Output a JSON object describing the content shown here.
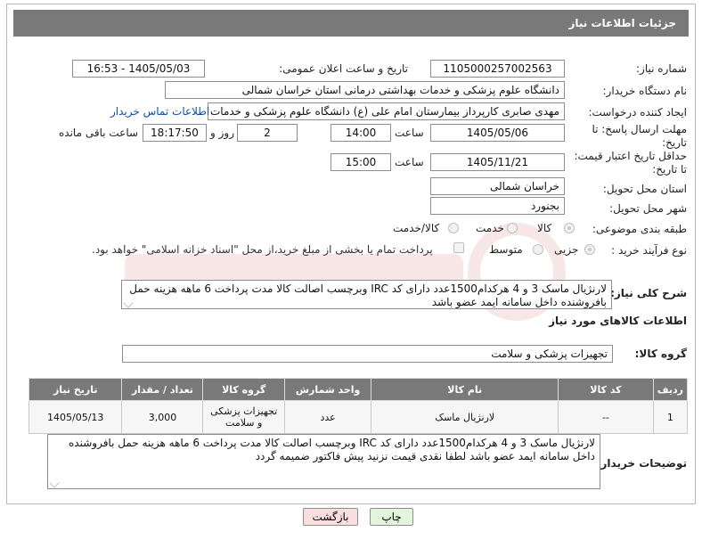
{
  "header": {
    "title": "جزئیات اطلاعات نیاز"
  },
  "fields": {
    "need_number": {
      "label": "شماره نیاز:",
      "value": "1105000257002563"
    },
    "announce_datetime": {
      "label": "تاریخ و ساعت اعلان عمومی:",
      "value": "1405/05/03 - 16:53"
    },
    "buyer_org": {
      "label": "نام دستگاه خریدار:",
      "value": "دانشگاه علوم پزشکی و خدمات بهداشتی درمانی استان خراسان شمالی"
    },
    "requester": {
      "label": "ایجاد کننده درخواست:",
      "value": "مهدی صابری کارپرداز بیمارستان امام علی (ع) دانشگاه علوم پزشکی و خدمات بهداشتی",
      "contact_link": "اطلاعات تماس خریدار"
    },
    "reply_deadline": {
      "label_line1": "مهلت ارسال پاسخ: تا",
      "label_line2": "تاریخ:",
      "date": "1405/05/06",
      "time_label": "ساعت",
      "time": "14:00",
      "days": "2",
      "days_label": "روز و",
      "remaining": "18:17:50",
      "remaining_label": "ساعت باقی مانده"
    },
    "price_validity": {
      "label_line1": "حداقل تاریخ اعتبار قیمت:",
      "label_line2": "تا تاریخ:",
      "date": "1405/11/21",
      "time_label": "ساعت",
      "time": "15:00"
    },
    "delivery_province": {
      "label": "استان محل تحویل:",
      "value": "خراسان شمالی"
    },
    "delivery_city": {
      "label": "شهر محل تحویل:",
      "value": "بجنورد"
    },
    "category": {
      "label": "طبقه بندی موضوعی:",
      "options": [
        "کالا",
        "خدمت",
        "کالا/خدمت"
      ],
      "selected": "کالا"
    },
    "purchase_type": {
      "label": "نوع فرآیند خرید :",
      "options": [
        "جزیی",
        "متوسط"
      ],
      "selected": "جزیی",
      "treasury_note": "پرداخت تمام یا بخشی از مبلغ خرید،از محل \"اسناد خزانه اسلامی\" خواهد بود."
    }
  },
  "description": {
    "label": "شرح کلی نیاز:",
    "value": "لارنژیال ماسک 3 و 4 هرکدام1500عدد دارای کد IRC وبرچسب اصالت کالا مدت پرداخت 6 ماهه هزینه حمل بافروشنده داخل سامانه ایمد عضو باشد"
  },
  "goods_info": {
    "title": "اطلاعات کالاهای مورد نیاز"
  },
  "goods_group": {
    "label": "گروه کالا:",
    "value": "تجهیزات پزشکی و سلامت"
  },
  "table": {
    "headers": [
      "ردیف",
      "کد کالا",
      "نام کالا",
      "واحد شمارش",
      "گروه کالا",
      "تعداد / مقدار",
      "تاریخ نیاز"
    ],
    "rows": [
      [
        "1",
        "--",
        "لارنژیال ماسک",
        "عدد",
        "تجهیزات پزشکی و سلامت",
        "3,000",
        "1405/05/13"
      ]
    ]
  },
  "buyer_notes": {
    "label": "توضیحات خریدار:",
    "value": "لارنژیال ماسک 3 و 4 هرکدام1500عدد دارای کد IRC وبرچسب اصالت کالا مدت پرداخت 6 ماهه هزینه حمل بافروشنده داخل سامانه ایمد عضو باشد لطفا نقدی قیمت نزنید  پیش فاکتور ضمیمه گردد"
  },
  "buttons": {
    "print": "چاپ",
    "back": "بازگشت"
  },
  "colors": {
    "header_bg": "#797979",
    "link": "#0b4fa8",
    "back_button_bg": "#f9dede",
    "print_button_bg": "#e4f5dd"
  }
}
